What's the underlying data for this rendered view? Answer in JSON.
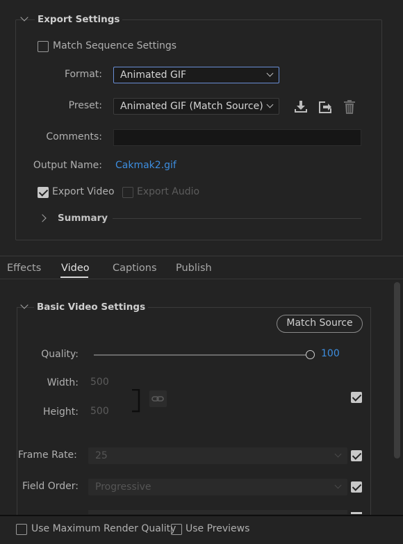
{
  "export_settings": {
    "title": "Export Settings",
    "match_sequence_label": "Match Sequence Settings",
    "match_sequence_checked": false,
    "format_label": "Format:",
    "format_value": "Animated GIF",
    "preset_label": "Preset:",
    "preset_value": "Animated GIF (Match Source)",
    "comments_label": "Comments:",
    "comments_value": "",
    "output_name_label": "Output Name:",
    "output_name_value": "Cakmak2.gif",
    "export_video_label": "Export Video",
    "export_video_checked": true,
    "export_audio_label": "Export Audio",
    "export_audio_checked": false,
    "summary_label": "Summary",
    "icons": [
      "save-preset-icon",
      "import-preset-icon",
      "delete-preset-icon"
    ]
  },
  "tabs": [
    {
      "label": "Effects",
      "active": false
    },
    {
      "label": "Video",
      "active": true
    },
    {
      "label": "Captions",
      "active": false
    },
    {
      "label": "Publish",
      "active": false
    }
  ],
  "basic_video": {
    "title": "Basic Video Settings",
    "match_source_label": "Match Source",
    "quality_label": "Quality:",
    "quality_value": "100",
    "width_label": "Width:",
    "width_value": "500",
    "height_label": "Height:",
    "height_value": "500",
    "dimensions_checked": true,
    "frame_rate_label": "Frame Rate:",
    "frame_rate_value": "25",
    "frame_rate_checked": true,
    "field_order_label": "Field Order:",
    "field_order_value": "Progressive",
    "field_order_checked": true
  },
  "footer": {
    "max_render_label": "Use Maximum Render Quality",
    "max_render_checked": false,
    "use_previews_label": "Use Previews",
    "use_previews_checked": false
  },
  "colors": {
    "background": "#232323",
    "accent_link": "#3d8ee0",
    "focus_border": "#6a8fd6"
  }
}
